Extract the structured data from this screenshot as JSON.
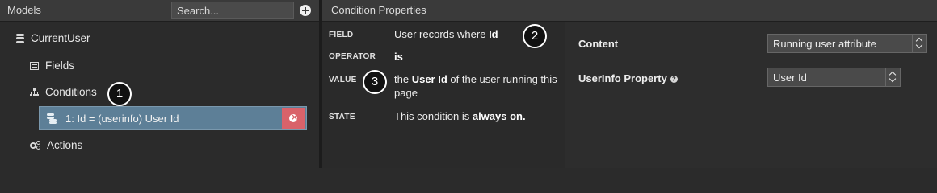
{
  "models_panel": {
    "title": "Models",
    "search_placeholder": "Search...",
    "model_name": "CurrentUser",
    "fields_label": "Fields",
    "conditions_label": "Conditions",
    "condition_item": "1: Id = (userinfo) User Id",
    "actions_label": "Actions"
  },
  "condition_properties": {
    "title": "Condition Properties",
    "field_key": "FIELD",
    "field_value_prefix": "User records where",
    "field_value_bold": "Id",
    "operator_key": "OPERATOR",
    "operator_value": "is",
    "value_key": "VALUE",
    "value_prefix": "the",
    "value_bold": "User Id",
    "value_suffix": "of the user running this page",
    "state_key": "STATE",
    "state_prefix": "This condition is",
    "state_bold": "always on."
  },
  "settings": {
    "content_label": "Content",
    "content_value": "Running user attribute",
    "userinfo_label": "UserInfo Property",
    "userinfo_value": "User Id"
  },
  "callouts": [
    "1",
    "2",
    "3"
  ],
  "colors": {
    "selected_row": "#5d7f97",
    "delete_button": "#d9626a"
  }
}
